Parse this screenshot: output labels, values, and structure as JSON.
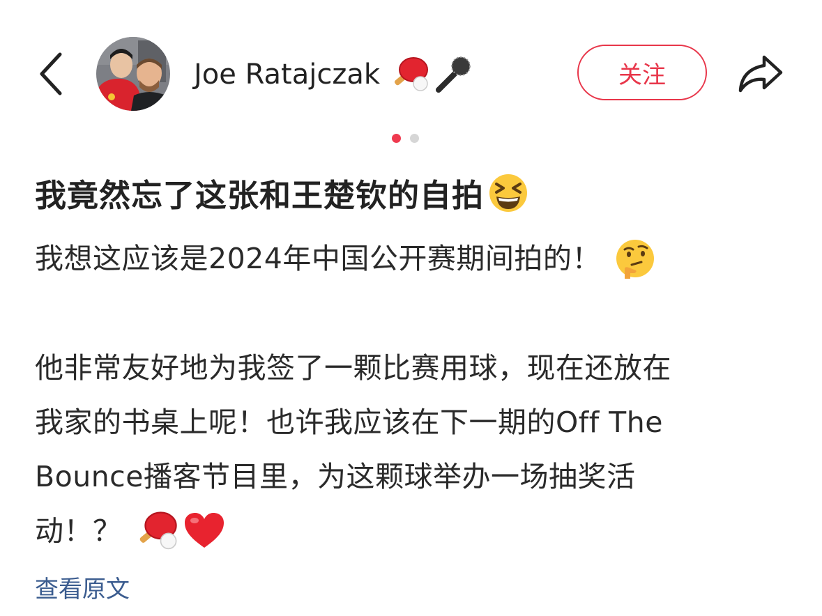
{
  "header": {
    "username": "Joe Ratajczak",
    "username_emojis": [
      "ping-pong-icon",
      "microphone-icon"
    ],
    "follow_label": "关注",
    "accent_color": "#e8364a"
  },
  "pager": {
    "count": 2,
    "active_index": 0
  },
  "post": {
    "title": "我竟然忘了这张和王楚钦的自拍",
    "title_emoji": "laughing-face-icon",
    "lines": [
      "我想这应该是2024年中国公开赛期间拍的！",
      "他非常友好地为我签了一颗比赛用球，现在还放在",
      "我家的书桌上呢！也许我应该在下一期的Off The",
      "Bounce播客节目里，为这颗球举办一场抽奖活",
      "动！？"
    ],
    "line1_emoji": "thinking-face-icon",
    "last_line_emojis": [
      "ping-pong-icon",
      "red-heart-icon"
    ],
    "view_original": "查看原文",
    "link_color": "#3b5c8f"
  }
}
